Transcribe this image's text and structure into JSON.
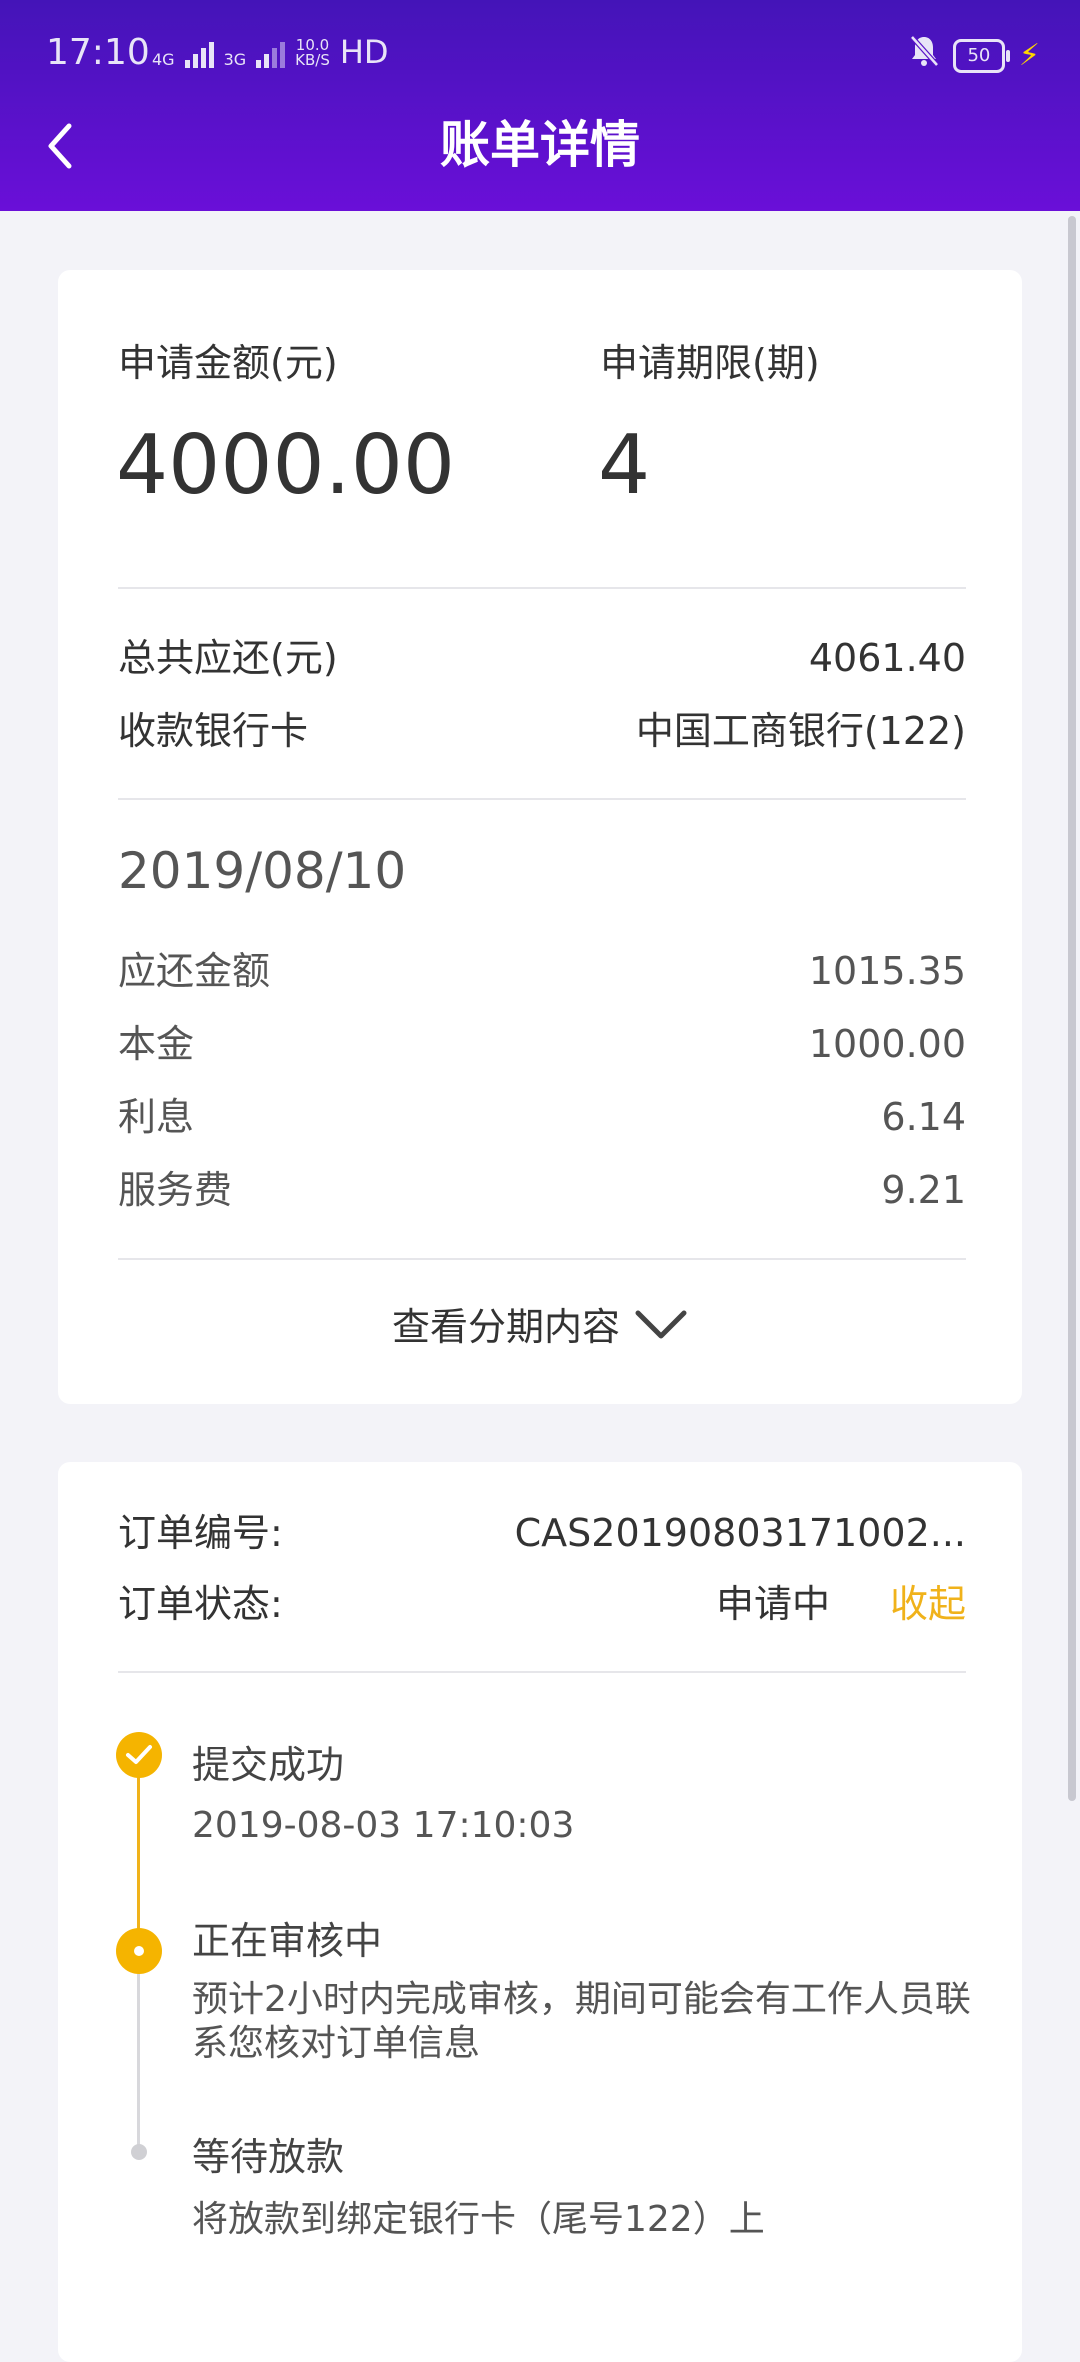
{
  "status_bar": {
    "time": "17:10",
    "net1": "4G",
    "net2": "3G",
    "speed_top": "10.0",
    "speed_bottom": "KB/S",
    "hd": "HD",
    "battery": "50"
  },
  "header": {
    "title": "账单详情"
  },
  "summary": {
    "amount_label": "申请金额(元)",
    "amount_value": "4000.00",
    "term_label": "申请期限(期)",
    "term_value": "4",
    "total_label": "总共应还(元)",
    "total_value": "4061.40",
    "bank_label": "收款银行卡",
    "bank_value": "中国工商银行(122)",
    "due_date": "2019/08/10",
    "details": [
      {
        "label": "应还金额",
        "value": "1015.35"
      },
      {
        "label": "本金",
        "value": "1000.00"
      },
      {
        "label": "利息",
        "value": "6.14"
      },
      {
        "label": "服务费",
        "value": "9.21"
      }
    ],
    "expand_label": "查看分期内容"
  },
  "order": {
    "number_label": "订单编号:",
    "number_value": "CAS20190803171002...",
    "status_label": "订单状态:",
    "status_value": "申请中",
    "collapse_label": "收起",
    "steps": [
      {
        "title": "提交成功",
        "desc": "2019-08-03 17:10:03"
      },
      {
        "title": "正在审核中",
        "desc": "预计2小时内完成审核，期间可能会有工作人员联系您核对订单信息"
      },
      {
        "title": "等待放款",
        "desc": "将放款到绑定银行卡（尾号122）上"
      }
    ]
  },
  "colors": {
    "header_top": "#4414b8",
    "header_bottom": "#6a0fd8",
    "accent": "#f0b21a"
  }
}
